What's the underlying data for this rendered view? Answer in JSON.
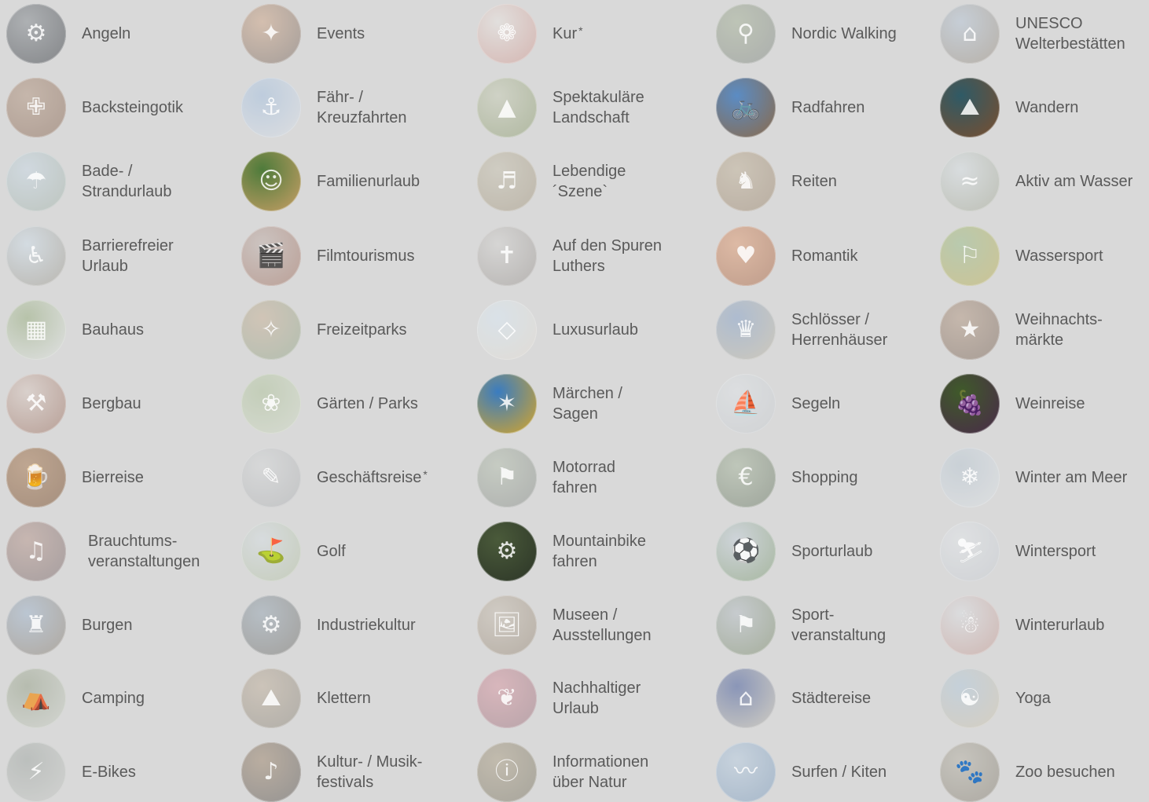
{
  "columns": [
    {
      "items": [
        {
          "label": "Angeln",
          "icon": "fishing-icon",
          "colors": [
            "#8a8f94",
            "#3e4247"
          ],
          "glyph": "⚙"
        },
        {
          "label": "Backsteingotik",
          "icon": "gothic-church-icon",
          "colors": [
            "#b59a86",
            "#8c6d5a"
          ],
          "glyph": "✙"
        },
        {
          "label": "Bade- /\nStrandurlaub",
          "icon": "beach-icon",
          "colors": [
            "#c9d8e4",
            "#a6b4a9"
          ],
          "glyph": "☂"
        },
        {
          "label": "Barrierefreier\nUrlaub",
          "icon": "accessibility-icon",
          "colors": [
            "#cfdde8",
            "#9f9a8e"
          ],
          "glyph": "♿"
        },
        {
          "label": "Bauhaus",
          "icon": "bauhaus-building-icon",
          "colors": [
            "#9bb083",
            "#e6e8ea"
          ],
          "glyph": "▦"
        },
        {
          "label": "Bergbau",
          "icon": "mining-icon",
          "colors": [
            "#d9c9c1",
            "#9c7060"
          ],
          "glyph": "⚒"
        },
        {
          "label": "Bierreise",
          "icon": "beer-icon",
          "colors": [
            "#a97d57",
            "#7a5233"
          ],
          "glyph": "🍺"
        },
        {
          "label": "Brauchtums-\nveranstaltungen",
          "icon": "tradition-icon",
          "colors": [
            "#b89a90",
            "#7d6e70"
          ],
          "glyph": "♫"
        },
        {
          "label": "Burgen",
          "icon": "castle-icon",
          "colors": [
            "#a2b6cc",
            "#8d8070"
          ],
          "glyph": "♜"
        },
        {
          "label": "Camping",
          "icon": "camping-icon",
          "colors": [
            "#9aa48d",
            "#cfd3cc"
          ],
          "glyph": "⛺"
        },
        {
          "label": "E-Bikes",
          "icon": "ebike-icon",
          "colors": [
            "#a4aaa6",
            "#cbcdca"
          ],
          "glyph": "⚡"
        }
      ]
    },
    {
      "items": [
        {
          "label": "Events",
          "icon": "events-icon",
          "colors": [
            "#cfa98c",
            "#7a6d66"
          ],
          "glyph": "✦"
        },
        {
          "label": "Fähr- /\nKreuzfahrten",
          "icon": "ferry-icon",
          "colors": [
            "#a8c2e0",
            "#dfe2e6"
          ],
          "glyph": "⚓"
        },
        {
          "label": "Familienurlaub",
          "icon": "family-icon",
          "colors": [
            "#4e7b3b",
            "#c99f66"
          ],
          "glyph": "☺",
          "vivid": true
        },
        {
          "label": "Filmtourismus",
          "icon": "film-camera-icon",
          "colors": [
            "#c1b2ac",
            "#a07060"
          ],
          "glyph": "🎬"
        },
        {
          "label": "Freizeitparks",
          "icon": "amusement-park-icon",
          "colors": [
            "#c9b39b",
            "#93a98f"
          ],
          "glyph": "✧"
        },
        {
          "label": "Gärten / Parks",
          "icon": "garden-icon",
          "colors": [
            "#b2c49f",
            "#d4dccb"
          ],
          "glyph": "❀"
        },
        {
          "label": "Geschäftsreise",
          "star": true,
          "icon": "business-icon",
          "colors": [
            "#d5d7d8",
            "#b0b2b4"
          ],
          "glyph": "✎"
        },
        {
          "label": "Golf",
          "icon": "golf-icon",
          "colors": [
            "#d6dde2",
            "#b5c2a3"
          ],
          "glyph": "⛳"
        },
        {
          "label": "Industriekultur",
          "icon": "industry-icon",
          "colors": [
            "#9aa8b4",
            "#75726c"
          ],
          "glyph": "⚙"
        },
        {
          "label": "Klettern",
          "icon": "climbing-icon",
          "colors": [
            "#c1b29f",
            "#8f8a80"
          ],
          "glyph": "⛰"
        },
        {
          "label": "Kultur- / Musik-\nfestivals",
          "icon": "music-festival-icon",
          "colors": [
            "#a08a72",
            "#5d5a58"
          ],
          "glyph": "♪"
        }
      ]
    },
    {
      "items": [
        {
          "label": "Kur",
          "star": true,
          "icon": "spa-icon",
          "colors": [
            "#e8e4e0",
            "#d09890"
          ],
          "glyph": "❁"
        },
        {
          "label": "Spektakuläre\nLandschaft",
          "icon": "landscape-icon",
          "colors": [
            "#c7ccb6",
            "#8e9d72"
          ],
          "glyph": "▲"
        },
        {
          "label": "Lebendige\n´Szene`",
          "icon": "music-scene-icon",
          "colors": [
            "#c7c2b0",
            "#a69a84"
          ],
          "glyph": "♬"
        },
        {
          "label": "Auf den Spuren\nLuthers",
          "icon": "luther-statue-icon",
          "colors": [
            "#d3d2d0",
            "#9a9591"
          ],
          "glyph": "✝"
        },
        {
          "label": "Luxusurlaub",
          "icon": "luxury-icon",
          "colors": [
            "#d9e8f4",
            "#e6ded2"
          ],
          "glyph": "◇"
        },
        {
          "label": "Märchen /\nSagen",
          "icon": "fairytale-icon",
          "colors": [
            "#3a7cc0",
            "#d6a529"
          ],
          "glyph": "✶",
          "vivid": true
        },
        {
          "label": "Motorrad\nfahren",
          "icon": "motorcycle-icon",
          "colors": [
            "#b6c0b0",
            "#8b8f8c"
          ],
          "glyph": "⚑"
        },
        {
          "label": "Mountainbike\nfahren",
          "icon": "mountainbike-icon",
          "colors": [
            "#4a5a3a",
            "#2c3527"
          ],
          "glyph": "⚙",
          "vivid": true
        },
        {
          "label": "Museen /\nAusstellungen",
          "icon": "museum-icon",
          "colors": [
            "#c8bfb2",
            "#9a8c7b"
          ],
          "glyph": "🖼"
        },
        {
          "label": "Nachhaltiger\nUrlaub",
          "icon": "sustainability-icon",
          "colors": [
            "#d79aa4",
            "#9d7882"
          ],
          "glyph": "❦"
        },
        {
          "label": "Informationen\nüber Natur",
          "icon": "nature-info-icon",
          "colors": [
            "#aea28a",
            "#7e7a6a"
          ],
          "glyph": "ⓘ"
        }
      ]
    },
    {
      "items": [
        {
          "label": "Nordic Walking",
          "icon": "nordic-walking-icon",
          "colors": [
            "#a7b39a",
            "#868b88"
          ],
          "glyph": "⚲"
        },
        {
          "label": "Radfahren",
          "icon": "cycling-icon",
          "colors": [
            "#5b8cc4",
            "#8a6a4a"
          ],
          "glyph": "🚲",
          "vivid": true
        },
        {
          "label": "Reiten",
          "icon": "horse-riding-icon",
          "colors": [
            "#c2b49c",
            "#9e8a74"
          ],
          "glyph": "♞"
        },
        {
          "label": "Romantik",
          "icon": "romance-sunset-icon",
          "colors": [
            "#e0a07a",
            "#a86a4a"
          ],
          "glyph": "♥"
        },
        {
          "label": "Schlösser /\nHerrenhäuser",
          "icon": "palace-icon",
          "colors": [
            "#8aa4c8",
            "#c4bba5"
          ],
          "glyph": "♛"
        },
        {
          "label": "Segeln",
          "icon": "sailing-icon",
          "colors": [
            "#dfe3e6",
            "#c8ccd0"
          ],
          "glyph": "⛵"
        },
        {
          "label": "Shopping",
          "icon": "shopping-icon",
          "colors": [
            "#a9b7a0",
            "#6d7a68"
          ],
          "glyph": "€"
        },
        {
          "label": "Sporturlaub",
          "icon": "sports-icon",
          "colors": [
            "#c6d0da",
            "#7d9a70"
          ],
          "glyph": "⚽"
        },
        {
          "label": "Sport-\nveranstaltung",
          "icon": "sports-event-icon",
          "colors": [
            "#b7bfc5",
            "#7b8b6a"
          ],
          "glyph": "⚑"
        },
        {
          "label": "Städtereise",
          "icon": "city-trip-icon",
          "colors": [
            "#4a5f9c",
            "#c8c2b0"
          ],
          "glyph": "⌂"
        },
        {
          "label": "Surfen / Kiten",
          "icon": "surfing-icon",
          "colors": [
            "#b9cde0",
            "#7e9cbc"
          ],
          "glyph": "〰"
        }
      ]
    },
    {
      "items": [
        {
          "label": "UNESCO\nWelterbestätten",
          "icon": "unesco-heritage-icon",
          "colors": [
            "#b7c5d4",
            "#9b8f80"
          ],
          "glyph": "⌂"
        },
        {
          "label": "Wandern",
          "icon": "hiking-backpack-icon",
          "colors": [
            "#2f5a66",
            "#7a4e2e"
          ],
          "glyph": "⛰",
          "vivid": true
        },
        {
          "label": "Aktiv am Wasser",
          "icon": "active-water-icon",
          "colors": [
            "#d8dfe3",
            "#a5aa98"
          ],
          "glyph": "≈"
        },
        {
          "label": "Wassersport",
          "icon": "water-sports-icon",
          "colors": [
            "#9ebd8c",
            "#c3b25c"
          ],
          "glyph": "⚐"
        },
        {
          "label": "Weihnachts-\nmärkte",
          "icon": "christmas-market-icon",
          "colors": [
            "#b59c88",
            "#7d6a5d"
          ],
          "glyph": "★"
        },
        {
          "label": "Weinreise",
          "icon": "wine-grapes-icon",
          "colors": [
            "#3f5a2a",
            "#4a2a4a"
          ],
          "glyph": "🍇",
          "vivid": true
        },
        {
          "label": "Winter am Meer",
          "icon": "winter-sea-icon",
          "colors": [
            "#bcc9d4",
            "#e1e4e6"
          ],
          "glyph": "❄"
        },
        {
          "label": "Wintersport",
          "icon": "skiing-icon",
          "colors": [
            "#e3e6e9",
            "#c7ccd2"
          ],
          "glyph": "⛷"
        },
        {
          "label": "Winterurlaub",
          "icon": "winter-holiday-icon",
          "colors": [
            "#dcdfe2",
            "#c59a92"
          ],
          "glyph": "☃"
        },
        {
          "label": "Yoga",
          "icon": "yoga-icon",
          "colors": [
            "#b4c8da",
            "#d2c6ae"
          ],
          "glyph": "☯"
        },
        {
          "label": "Zoo besuchen",
          "icon": "zoo-icon",
          "colors": [
            "#b7b3a7",
            "#888275"
          ],
          "glyph": "🐾"
        }
      ]
    }
  ]
}
